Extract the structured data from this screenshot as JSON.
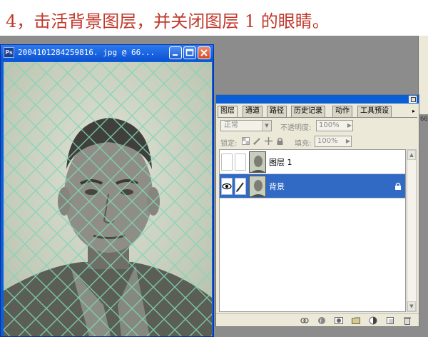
{
  "instruction": "4，击活背景图层，并关闭图层 1 的眼睛。",
  "document_window": {
    "title": "2004101284259816. jpg @ 66...",
    "app_icon": "ps-app-icon",
    "buttons": [
      "minimize",
      "maximize",
      "close"
    ]
  },
  "right_stub": {
    "zoom_text": "66"
  },
  "layers_palette": {
    "tabs": [
      "图层",
      "通道",
      "路径",
      "历史记录",
      "动作",
      "工具预设"
    ],
    "active_tab": "图层",
    "blend_mode": "正常",
    "opacity_label": "不透明度:",
    "opacity_value": "100%",
    "lock_label": "锁定:",
    "fill_label": "填充:",
    "fill_value": "100%",
    "layers": [
      {
        "name": "图层 1",
        "visible": false,
        "selected": false,
        "locked": false
      },
      {
        "name": "背景",
        "visible": true,
        "selected": true,
        "locked": true
      }
    ],
    "bottom_icons": [
      "link-layers-icon",
      "layer-style-icon",
      "layer-mask-icon",
      "new-set-icon",
      "adjustment-layer-icon",
      "new-layer-icon",
      "delete-layer-icon"
    ],
    "colors": {
      "selection": "#316ac5",
      "panel": "#ece9d8",
      "titlebar": "#0b5fd6"
    }
  }
}
